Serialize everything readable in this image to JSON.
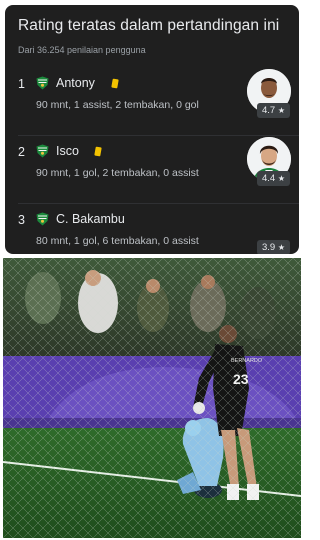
{
  "card": {
    "title": "Rating teratas dalam pertandingan ini",
    "subtitle": "Dari 36.254 penilaian pengguna",
    "accent_card": "#f2c200",
    "players": [
      {
        "rank": "1",
        "name": "Antony",
        "yellow_card": true,
        "stats": "90 mnt, 1 assist, 2 tembakan, 0 gol",
        "rating": "4.7",
        "star": "★",
        "avatar_icon": "player-photo-antony"
      },
      {
        "rank": "2",
        "name": "Isco",
        "yellow_card": true,
        "stats": "90 mnt, 1 gol, 2 tembakan, 0 assist",
        "rating": "4.4",
        "star": "★",
        "avatar_icon": "player-photo-isco"
      },
      {
        "rank": "3",
        "name": "C. Bakambu",
        "yellow_card": false,
        "stats": "80 mnt, 1 gol, 6 tembakan, 0 assist",
        "rating": "3.9",
        "star": "★",
        "avatar_icon": null
      }
    ]
  },
  "photo": {
    "jersey_number": "23",
    "jersey_name": "BERNARDO",
    "description_icon": "match-photo-goalkeeper-scene"
  }
}
